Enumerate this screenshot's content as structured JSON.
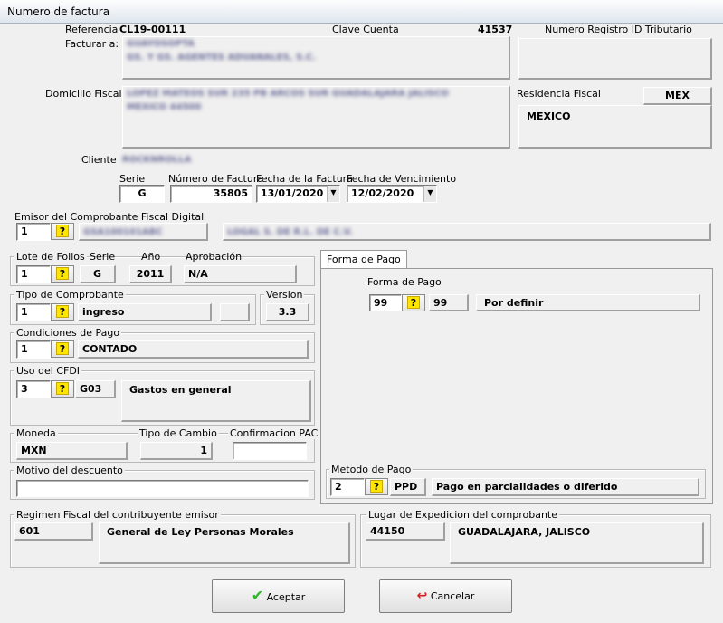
{
  "window": {
    "title": "Numero de factura"
  },
  "referencia": {
    "label": "Referencia",
    "value": "CL19-00111"
  },
  "clave_cuenta": {
    "label": "Clave Cuenta",
    "value": "41537"
  },
  "numero_registro": {
    "label": "Numero Registro ID Tributario",
    "value": ""
  },
  "facturar_a": {
    "label": "Facturar a:",
    "line1": "GUAYOSOPTA",
    "line2": "GS. Y GS. AGENTES ADUANALES, S.C."
  },
  "domicilio": {
    "label": "Domicilio Fiscal",
    "line1": "LOPEZ MATEOS SUR 235 PB ARCOS SUR GUADALAJARA JALISCO",
    "line2": "MEXICO 44500"
  },
  "residencia": {
    "label": "Residencia Fiscal",
    "code": "MEX",
    "name": "MEXICO"
  },
  "cliente": {
    "label": "Cliente",
    "value": "ROCKNROLLA"
  },
  "serie": {
    "label": "Serie",
    "value": "G"
  },
  "numero_factura": {
    "label": "Número de Factura",
    "value": "35805"
  },
  "fecha_factura": {
    "label": "Fecha de la Factura",
    "value": "13/01/2020"
  },
  "fecha_vencimiento": {
    "label": "Fecha de Vencimiento",
    "value": "12/02/2020"
  },
  "emisor": {
    "label": "Emisor del Comprobante Fiscal Digital",
    "value": "1",
    "rfc": "GSA100101ABC",
    "nombre": "LOGAL S. DE R.L. DE C.V."
  },
  "lote": {
    "title": "Lote de Folios",
    "value": "1",
    "serie_label": "Serie",
    "serie_value": "G",
    "anio_label": "Año",
    "anio_value": "2011",
    "aprob_label": "Aprobación",
    "aprob_value": "N/A"
  },
  "tipo_comprobante": {
    "title": "Tipo de Comprobante",
    "value": "1",
    "desc": "ingreso"
  },
  "version": {
    "title": "Version",
    "value": "3.3"
  },
  "condiciones": {
    "title": "Condiciones de Pago",
    "value": "1",
    "desc": "CONTADO"
  },
  "uso_cfdi": {
    "title": "Uso del CFDI",
    "value": "3",
    "code": "G03",
    "desc": "Gastos en general"
  },
  "moneda": {
    "label": "Moneda",
    "value": "MXN",
    "tipo_cambio_label": "Tipo de Cambio",
    "tipo_cambio_value": "1",
    "confirmacion_label": "Confirmacion PAC"
  },
  "motivo": {
    "title": "Motivo del descuento",
    "value": ""
  },
  "tab": {
    "label": "Forma de Pago"
  },
  "forma_pago": {
    "title": "Forma de Pago",
    "value": "99",
    "code": "99",
    "desc": "Por definir"
  },
  "metodo_pago": {
    "title": "Metodo de Pago",
    "value": "2",
    "code": "PPD",
    "desc": "Pago en parcialidades o diferido"
  },
  "regimen": {
    "title": "Regimen Fiscal del contribuyente emisor",
    "code": "601",
    "desc": "General de Ley Personas Morales"
  },
  "lugar": {
    "title": "Lugar de Expedicion del comprobante",
    "code": "44150",
    "desc": "GUADALAJARA, JALISCO"
  },
  "buttons": {
    "ok": "Aceptar",
    "cancel": "Cancelar"
  },
  "icons": {
    "question": "?",
    "dropdown": "▼",
    "check": "✔",
    "undo": "↩"
  },
  "colors": {
    "check": "#2db52d",
    "cancel": "#d62020",
    "question_bg": "#ffe600"
  }
}
